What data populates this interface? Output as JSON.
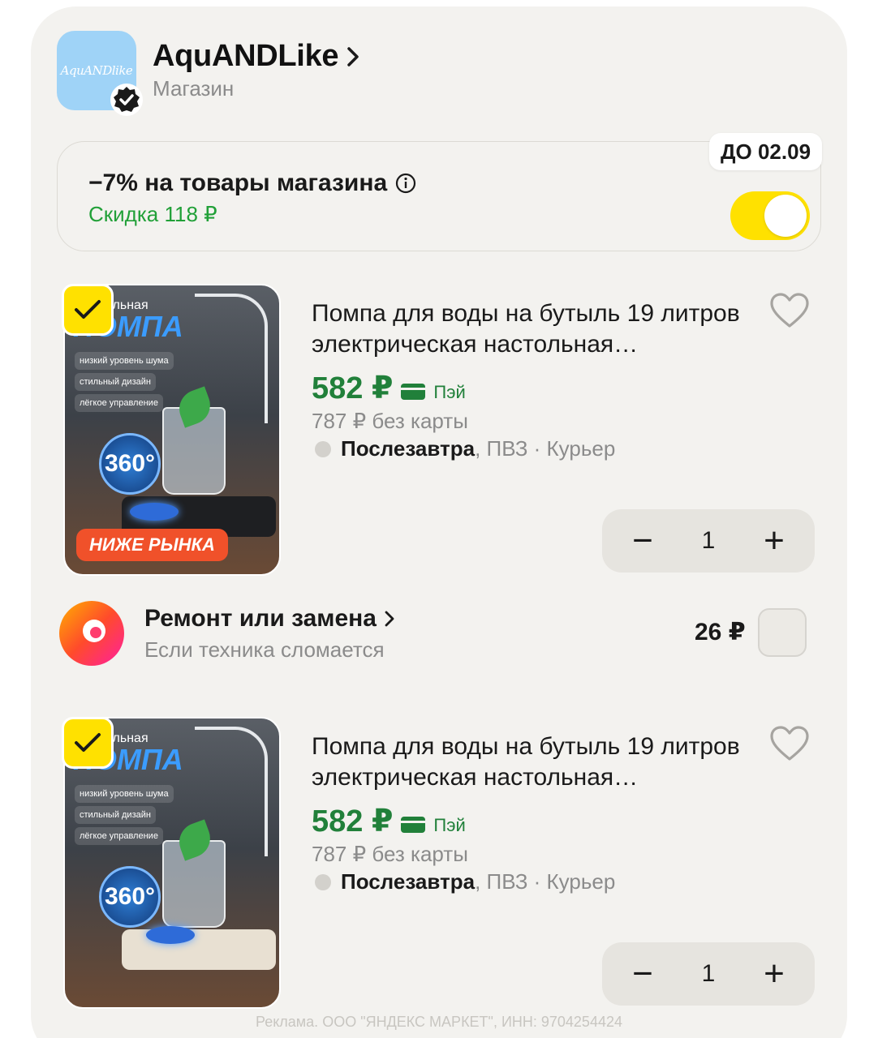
{
  "store": {
    "logo_text": "AquANDlike",
    "name": "AquANDLike",
    "subtitle": "Магазин"
  },
  "promo": {
    "title": "−7% на товары магазина",
    "discount": "Скидка 118 ₽",
    "deadline": "ДО 02.09",
    "toggle_on": true
  },
  "products": [
    {
      "title": "Помпа для воды на бутыль 19 литров электрическая настольная…",
      "price": "582 ₽",
      "pay_label": "Пэй",
      "old_price": "787 ₽  без карты",
      "delivery_strong": "Послезавтра",
      "delivery_rest": ", ПВЗ · Курьер",
      "quantity": "1",
      "img_top": "ольная",
      "img_big": "ПОМПА",
      "img_chips": [
        "низкий уровень шума",
        "стильный дизайн",
        "лёгкое управление"
      ],
      "img_360": "360°",
      "badge": "НИЖЕ РЫНКА",
      "checked": true
    },
    {
      "title": "Помпа для воды на бутыль 19 литров электрическая настольная…",
      "price": "582 ₽",
      "pay_label": "Пэй",
      "old_price": "787 ₽  без карты",
      "delivery_strong": "Послезавтра",
      "delivery_rest": ", ПВЗ · Курьер",
      "quantity": "1",
      "img_top": "ольная",
      "img_big": "ПОМПА",
      "img_chips": [
        "низкий уровень шума",
        "стильный дизайн",
        "лёгкое управление"
      ],
      "img_360": "360°",
      "checked": true
    }
  ],
  "repair": {
    "title": "Ремонт или замена",
    "subtitle": "Если техника сломается",
    "price": "26 ₽",
    "checked": false
  },
  "stepper": {
    "minus": "−",
    "plus": "+"
  },
  "footer": "Реклама. ООО \"ЯНДЕКС МАРКЕТ\", ИНН: 9704254424",
  "colors": {
    "accent_yellow": "#ffe100",
    "price_green": "#21803a",
    "discount_green": "#21a038"
  }
}
